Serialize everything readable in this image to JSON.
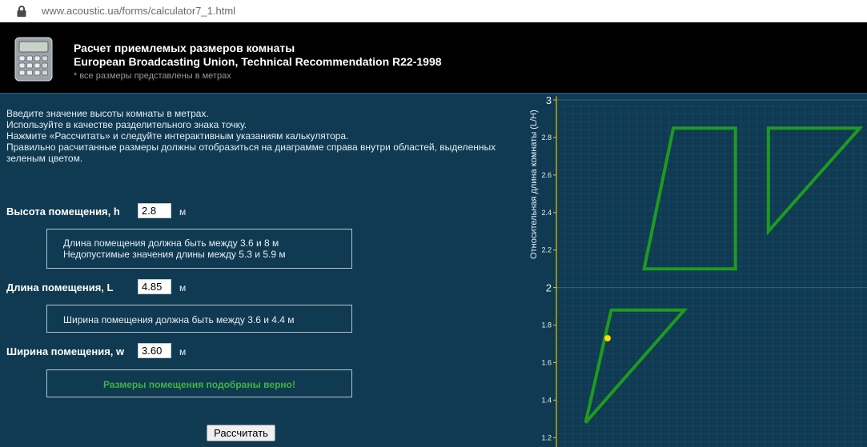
{
  "browser": {
    "url": "www.acoustic.ua/forms/calculator7_1.html"
  },
  "header": {
    "title_line1": "Расчет приемлемых размеров комнаты",
    "title_line2": "European Broadcasting Union, Technical Recommendation R22-1998",
    "note": "* все размеры представлены в метрах"
  },
  "instructions": [
    "Введите значение высоты комнаты в метрах.",
    "Используйте в качестве разделительного знака точку.",
    "Нажмите «Рассчитать» и следуйте интерактивным указаниям калькулятора.",
    "Правильно расчитанные размеры должны отобразиться на диаграмме справа внутри областей, выделенных зеленым цветом."
  ],
  "form": {
    "height": {
      "label": "Высота помещения, h",
      "value": "2.8",
      "unit": "м"
    },
    "length": {
      "label": "Длина помещения, L",
      "value": "4.85",
      "unit": "м"
    },
    "width": {
      "label": "Ширина помещения, w",
      "value": "3.60",
      "unit": "м"
    },
    "length_hint_line1": "Длина помещения должна быть между 3.6 и 8 м",
    "length_hint_line2": "Недопустимые значения длины между 5.3 и 5.9 м",
    "width_hint": "Ширина помещения должна быть между 3.6 и 4.4 м",
    "result_message": "Размеры помещения подобраны верно!",
    "calculate_label": "Рассчитать"
  },
  "colors": {
    "background": "#0f3a52",
    "accent_green": "#1f9a1f",
    "success_text": "#3fb53f",
    "marker": "#ffe000",
    "axis": "#f0c000"
  },
  "chart_data": {
    "type": "scatter",
    "ylabel": "Относительная длина комнаты (L/H)",
    "ylim": [
      1.15,
      3.03
    ],
    "xlim": [
      1.0,
      1.85
    ],
    "y_ticks": [
      {
        "value": 1.2,
        "label": "1.2",
        "major": false
      },
      {
        "value": 1.4,
        "label": "1.4",
        "major": false
      },
      {
        "value": 1.6,
        "label": "1.6",
        "major": false
      },
      {
        "value": 1.8,
        "label": "1.8",
        "major": false
      },
      {
        "value": 2.0,
        "label": "2",
        "major": true
      },
      {
        "value": 2.2,
        "label": "2.2",
        "major": false
      },
      {
        "value": 2.4,
        "label": "2.4",
        "major": false
      },
      {
        "value": 2.6,
        "label": "2.6",
        "major": false
      },
      {
        "value": 2.8,
        "label": "2.8",
        "major": false
      },
      {
        "value": 3.0,
        "label": "3",
        "major": true
      }
    ],
    "regions": [
      {
        "points": [
          [
            1.24,
            2.1
          ],
          [
            1.32,
            2.85
          ],
          [
            1.49,
            2.85
          ],
          [
            1.49,
            2.1
          ]
        ]
      },
      {
        "points": [
          [
            1.58,
            2.3
          ],
          [
            1.58,
            2.85
          ],
          [
            1.83,
            2.85
          ]
        ]
      },
      {
        "points": [
          [
            1.08,
            1.28
          ],
          [
            1.15,
            1.88
          ],
          [
            1.35,
            1.88
          ]
        ]
      }
    ],
    "point": {
      "x": 1.14,
      "y": 1.73
    }
  }
}
